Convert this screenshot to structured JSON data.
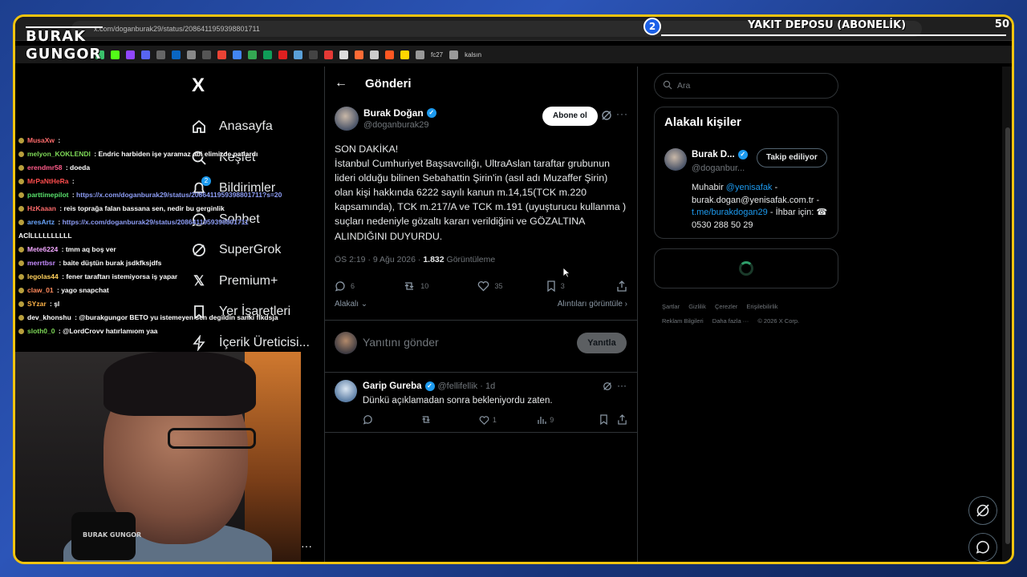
{
  "browser": {
    "url": "x.com/doganburak29/status/2086411959398801711",
    "bookmarks": [
      "fc27",
      "kalsın"
    ]
  },
  "overlay": {
    "logo_line1": "BURAK",
    "logo_line2": "GUNGOR",
    "goal_number": "2",
    "goal_title": "YAKIT DEPOSU (ABONELİK)",
    "goal_count": "50",
    "mic_logo": "BURAK GUNGOR"
  },
  "nav": {
    "logo": "X",
    "items": [
      {
        "label": "Anasayfa",
        "icon": "home-icon"
      },
      {
        "label": "Keşfet",
        "icon": "search-icon"
      },
      {
        "label": "Bildirimler",
        "icon": "bell-icon"
      },
      {
        "label": "Sohbet",
        "icon": "chat-icon"
      },
      {
        "label": "SuperGrok",
        "icon": "grok-icon"
      },
      {
        "label": "Premium+",
        "icon": "x-icon"
      },
      {
        "label": "Yer İşaretleri",
        "icon": "bookmark-icon"
      },
      {
        "label": "İçerik Üreticisi...",
        "icon": "lightning-icon"
      }
    ],
    "notification_badge": "2"
  },
  "chat": [
    {
      "user": "MusaXw",
      "color": "#ff6b6b",
      "message": ""
    },
    {
      "user": "melyon_KOKLENDI",
      "color": "#7ed957",
      "message": "Endric harbiden işe yaramaz abi elimizde patlardı"
    },
    {
      "user": "erendmr58",
      "color": "#ff5c8a",
      "message": "doeda"
    },
    {
      "user": "MrPaNtHeRa",
      "color": "#ff4d4d",
      "message": ""
    },
    {
      "user": "parttimepilot",
      "color": "#58e06b",
      "message": "https://x.com/doganburak29/status/2086411959398801711?s=20"
    },
    {
      "user": "HzKaaan",
      "color": "#ff6b6b",
      "message": "reis toprağa falan bassana sen, nedir bu gerginlik"
    },
    {
      "user": "aresArtz",
      "color": "#6ba7ff",
      "message": "https://x.com/doganburak29/status/2086411959398801711"
    },
    {
      "user": "",
      "color": "#ffffff",
      "message": "ACİLLLLLLLLLL"
    },
    {
      "user": "Mete6224",
      "color": "#f2a7ff",
      "message": "tmm aq boş ver"
    },
    {
      "user": "merrtbsr",
      "color": "#c58bff",
      "message": "baite düştün burak jsdkfksjdfs"
    },
    {
      "user": "legolas44",
      "color": "#ffd05c",
      "message": "fener taraftarı istemiyorsa iş yapar"
    },
    {
      "user": "claw_01",
      "color": "#ff8a5c",
      "message": "yago snapchat"
    },
    {
      "user": "SYzar",
      "color": "#ffb347",
      "message": "şl"
    },
    {
      "user": "dev_khonshu",
      "color": "#ffffff",
      "message": "@burakgungor BETO yu istemeyen sen degildin sanki flkdsja"
    },
    {
      "user": "sloth0_0",
      "color": "#7ed957",
      "message": "@LordCrovv hatırlamıom yaa"
    }
  ],
  "post": {
    "header_title": "Gönderi",
    "author_name": "Burak Doğan",
    "author_handle": "@doganburak29",
    "subscribe_label": "Abone ol",
    "text_lines": [
      "SON DAKİKA!",
      "İstanbul Cumhuriyet Başsavcılığı, UltraAslan taraftar grubunun",
      "lideri olduğu bilinen Sebahattin Şirin'in (asıl adı Muzaffer Şirin)",
      "olan kişi hakkında 6222 sayılı kanun m.14,15(TCK m.220",
      "kapsamında),  TCK m.217/A ve TCK m.191 (uyuşturucu kullanma )",
      "suçları nedeniyle gözaltı kararı verildiğini ve GÖZALTINA",
      "ALINDIĞINI DUYURDU."
    ],
    "time": "ÖS 2:19 · 9 Ağu 2026 · ",
    "views": "1.832",
    "views_label": " Görüntüleme",
    "replies": "6",
    "reposts": "10",
    "likes": "35",
    "bookmarks": "3",
    "related_label": "Alakalı",
    "quotes_label": "Alıntıları görüntüle",
    "reply_placeholder": "Yanıtını gönder",
    "reply_button": "Yanıtla"
  },
  "comment": {
    "name": "Garip Gureba",
    "handle": "@fellifellik · 1d",
    "text": "Dünkü açıklamadan sonra bekleniyordu zaten.",
    "likes": "1",
    "views": "9"
  },
  "sidebar": {
    "search_placeholder": "Ara",
    "related_title": "Alakalı kişiler",
    "person_name": "Burak D...",
    "person_handle": "@doganbur...",
    "follow_label": "Takip ediliyor",
    "bio_prefix": "Muhabir ",
    "bio_link1": "@yenisafak",
    "bio_mid": " - burak.dogan@yenisafak.com.tr - ",
    "bio_link2": "t.me/burakdogan29",
    "bio_suffix": " - İhbar için: ",
    "bio_phone": "☎ 0530 288 50 29",
    "footer_links": [
      "Şartlar",
      "Gizlilik",
      "Çerezler",
      "Erişilebilirlik",
      "Reklam Bilgileri",
      "Daha fazla ···",
      "© 2026 X Corp."
    ]
  },
  "colors": {
    "accent": "#1d9bf0",
    "frame_border": "#f1c40f",
    "background": "#000000"
  }
}
